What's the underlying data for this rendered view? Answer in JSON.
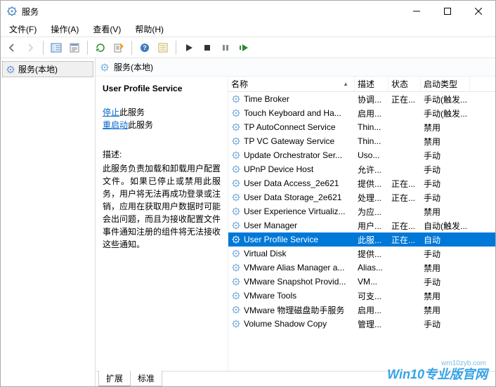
{
  "window": {
    "title": "服务"
  },
  "menu": {
    "file": "文件(F)",
    "action": "操作(A)",
    "view": "查看(V)",
    "help": "帮助(H)"
  },
  "left": {
    "services_local": "服务(本地)"
  },
  "right_header": {
    "title": "服务(本地)"
  },
  "detail": {
    "name": "User Profile Service",
    "stop_prefix": "停止",
    "stop_suffix": "此服务",
    "restart_prefix": "重启动",
    "restart_suffix": "此服务",
    "desc_label": "描述:",
    "desc_text": "此服务负责加载和卸载用户配置文件。如果已停止或禁用此服务，用户将无法再成功登录或注销，应用在获取用户数据时可能会出问题，而且为接收配置文件事件通知注册的组件将无法接收这些通知。"
  },
  "columns": {
    "name": "名称",
    "desc": "描述",
    "status": "状态",
    "startup": "启动类型"
  },
  "rows": [
    {
      "name": "Time Broker",
      "desc": "协调...",
      "status": "正在...",
      "startup": "手动(触发..."
    },
    {
      "name": "Touch Keyboard and Ha...",
      "desc": "启用...",
      "status": "",
      "startup": "手动(触发..."
    },
    {
      "name": "TP AutoConnect Service",
      "desc": "Thin...",
      "status": "",
      "startup": "禁用"
    },
    {
      "name": "TP VC Gateway Service",
      "desc": "Thin...",
      "status": "",
      "startup": "禁用"
    },
    {
      "name": "Update Orchestrator Ser...",
      "desc": "Uso...",
      "status": "",
      "startup": "手动"
    },
    {
      "name": "UPnP Device Host",
      "desc": "允许...",
      "status": "",
      "startup": "手动"
    },
    {
      "name": "User Data Access_2e621",
      "desc": "提供...",
      "status": "正在...",
      "startup": "手动"
    },
    {
      "name": "User Data Storage_2e621",
      "desc": "处理...",
      "status": "正在...",
      "startup": "手动"
    },
    {
      "name": "User Experience Virtualiz...",
      "desc": "为应...",
      "status": "",
      "startup": "禁用"
    },
    {
      "name": "User Manager",
      "desc": "用户...",
      "status": "正在...",
      "startup": "自动(触发..."
    },
    {
      "name": "User Profile Service",
      "desc": "此服...",
      "status": "正在...",
      "startup": "自动",
      "selected": true
    },
    {
      "name": "Virtual Disk",
      "desc": "提供...",
      "status": "",
      "startup": "手动"
    },
    {
      "name": "VMware Alias Manager a...",
      "desc": "Alias...",
      "status": "",
      "startup": "禁用"
    },
    {
      "name": "VMware Snapshot Provid...",
      "desc": "VM...",
      "status": "",
      "startup": "手动"
    },
    {
      "name": "VMware Tools",
      "desc": "可支...",
      "status": "",
      "startup": "禁用"
    },
    {
      "name": "VMware 物理磁盘助手服务",
      "desc": "启用...",
      "status": "",
      "startup": "禁用"
    },
    {
      "name": "Volume Shadow Copy",
      "desc": "管理...",
      "status": "",
      "startup": "手动"
    }
  ],
  "tabs": {
    "extended": "扩展",
    "standard": "标准"
  },
  "watermark": {
    "url": "wm10zyb.com",
    "brand": "Win10专业版官网"
  }
}
